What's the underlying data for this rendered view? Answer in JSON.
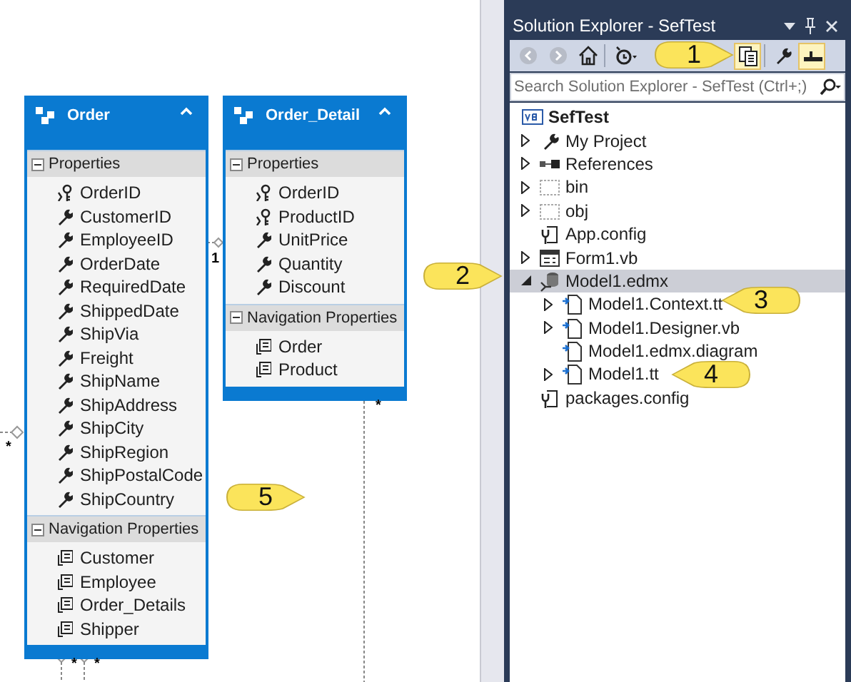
{
  "diagram": {
    "entities": [
      {
        "name": "Order",
        "expanded": true,
        "sections": [
          {
            "title": "Properties",
            "expanded": true,
            "members": [
              {
                "name": "OrderID",
                "kind": "key"
              },
              {
                "name": "CustomerID",
                "kind": "property"
              },
              {
                "name": "EmployeeID",
                "kind": "property"
              },
              {
                "name": "OrderDate",
                "kind": "property"
              },
              {
                "name": "RequiredDate",
                "kind": "property"
              },
              {
                "name": "ShippedDate",
                "kind": "property"
              },
              {
                "name": "ShipVia",
                "kind": "property"
              },
              {
                "name": "Freight",
                "kind": "property"
              },
              {
                "name": "ShipName",
                "kind": "property"
              },
              {
                "name": "ShipAddress",
                "kind": "property"
              },
              {
                "name": "ShipCity",
                "kind": "property"
              },
              {
                "name": "ShipRegion",
                "kind": "property"
              },
              {
                "name": "ShipPostalCode",
                "kind": "property"
              },
              {
                "name": "ShipCountry",
                "kind": "property"
              }
            ]
          },
          {
            "title": "Navigation Properties",
            "expanded": true,
            "members": [
              {
                "name": "Customer",
                "kind": "nav"
              },
              {
                "name": "Employee",
                "kind": "nav"
              },
              {
                "name": "Order_Details",
                "kind": "nav"
              },
              {
                "name": "Shipper",
                "kind": "nav"
              }
            ]
          }
        ]
      },
      {
        "name": "Order_Detail",
        "expanded": true,
        "sections": [
          {
            "title": "Properties",
            "expanded": true,
            "members": [
              {
                "name": "OrderID",
                "kind": "key"
              },
              {
                "name": "ProductID",
                "kind": "key"
              },
              {
                "name": "UnitPrice",
                "kind": "property"
              },
              {
                "name": "Quantity",
                "kind": "property"
              },
              {
                "name": "Discount",
                "kind": "property"
              }
            ]
          },
          {
            "title": "Navigation Properties",
            "expanded": true,
            "members": [
              {
                "name": "Order",
                "kind": "nav"
              },
              {
                "name": "Product",
                "kind": "nav"
              }
            ]
          }
        ]
      }
    ],
    "connectors": [
      {
        "label": "1"
      },
      {
        "label": "*"
      },
      {
        "label": "*"
      },
      {
        "label": "*"
      },
      {
        "label": "*"
      }
    ]
  },
  "solution_explorer": {
    "title": "Solution Explorer - SefTest",
    "toolbar": [
      {
        "kind": "back",
        "selected": false
      },
      {
        "kind": "forward",
        "selected": false
      },
      {
        "kind": "home",
        "selected": false
      },
      {
        "kind": "history",
        "selected": false
      },
      {
        "kind": "files",
        "selected": true
      },
      {
        "kind": "wrench",
        "selected": false
      },
      {
        "kind": "preview",
        "selected": true
      }
    ],
    "search": {
      "placeholder": "Search Solution Explorer - SefTest (Ctrl+;)"
    },
    "project": {
      "name": "SefTest",
      "children": [
        {
          "name": "My Project",
          "kind": "wrench",
          "expanded": false,
          "selected": false
        },
        {
          "name": "References",
          "kind": "references",
          "expanded": false,
          "selected": false
        },
        {
          "name": "bin",
          "kind": "folder",
          "expanded": false,
          "selected": false
        },
        {
          "name": "obj",
          "kind": "folder",
          "expanded": false,
          "selected": false
        },
        {
          "name": "App.config",
          "kind": "config",
          "selected": false
        },
        {
          "name": "Form1.vb",
          "kind": "form",
          "expanded": false,
          "selected": false
        },
        {
          "name": "Model1.edmx",
          "kind": "edmx",
          "expanded": true,
          "selected": true,
          "children": [
            {
              "name": "Model1.Context.tt",
              "kind": "tt",
              "expanded": false,
              "selected": false
            },
            {
              "name": "Model1.Designer.vb",
              "kind": "tt",
              "expanded": false,
              "selected": false
            },
            {
              "name": "Model1.edmx.diagram",
              "kind": "tt",
              "selected": false
            },
            {
              "name": "Model1.tt",
              "kind": "tt",
              "expanded": false,
              "selected": false
            }
          ]
        },
        {
          "name": "packages.config",
          "kind": "config",
          "selected": false
        }
      ]
    }
  },
  "callouts": [
    {
      "text": "1",
      "kind": "right"
    },
    {
      "text": "2",
      "kind": "right"
    },
    {
      "text": "3",
      "kind": "left"
    },
    {
      "text": "4",
      "kind": "left"
    },
    {
      "text": "5",
      "kind": "right"
    }
  ]
}
